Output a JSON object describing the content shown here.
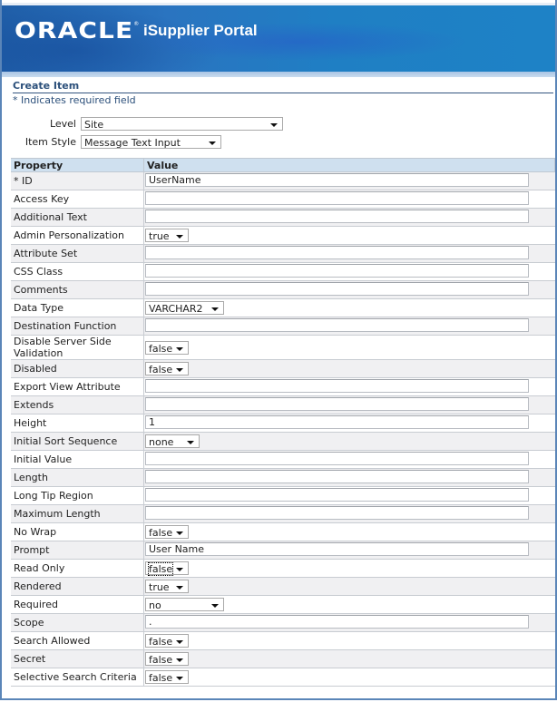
{
  "header": {
    "brand": "ORACLE",
    "brand_mark": "®",
    "product": "iSupplier Portal"
  },
  "page": {
    "title": "Create Item",
    "required_note": "* Indicates required field"
  },
  "form": {
    "level_label": "Level",
    "level_value": "Site",
    "item_style_label": "Item Style",
    "item_style_value": "Message Text Input"
  },
  "table": {
    "headers": [
      "Property",
      "Value"
    ],
    "rows": [
      {
        "property": "* ID",
        "type": "text",
        "value": "UserName"
      },
      {
        "property": "Access Key",
        "type": "text",
        "value": ""
      },
      {
        "property": "Additional Text",
        "type": "text",
        "value": ""
      },
      {
        "property": "Admin Personalization",
        "type": "select",
        "value": "true"
      },
      {
        "property": "Attribute Set",
        "type": "text",
        "value": ""
      },
      {
        "property": "CSS Class",
        "type": "text",
        "value": ""
      },
      {
        "property": "Comments",
        "type": "text",
        "value": ""
      },
      {
        "property": "Data Type",
        "type": "select",
        "value": "VARCHAR2"
      },
      {
        "property": "Destination Function",
        "type": "text",
        "value": ""
      },
      {
        "property": "Disable Server Side Validation",
        "type": "select",
        "value": "false"
      },
      {
        "property": "Disabled",
        "type": "select",
        "value": "false"
      },
      {
        "property": "Export View Attribute",
        "type": "text",
        "value": ""
      },
      {
        "property": "Extends",
        "type": "text",
        "value": ""
      },
      {
        "property": "Height",
        "type": "text",
        "value": "1"
      },
      {
        "property": "Initial Sort Sequence",
        "type": "select",
        "value": "none"
      },
      {
        "property": "Initial Value",
        "type": "text",
        "value": ""
      },
      {
        "property": "Length",
        "type": "text",
        "value": ""
      },
      {
        "property": "Long Tip Region",
        "type": "text",
        "value": ""
      },
      {
        "property": "Maximum Length",
        "type": "text",
        "value": ""
      },
      {
        "property": "No Wrap",
        "type": "select",
        "value": "false"
      },
      {
        "property": "Prompt",
        "type": "text",
        "value": "User Name"
      },
      {
        "property": "Read Only",
        "type": "select",
        "value": "false",
        "focused": true
      },
      {
        "property": "Rendered",
        "type": "select",
        "value": "true"
      },
      {
        "property": "Required",
        "type": "select",
        "value": "no"
      },
      {
        "property": "Scope",
        "type": "text",
        "value": "."
      },
      {
        "property": "Search Allowed",
        "type": "select",
        "value": "false"
      },
      {
        "property": "Secret",
        "type": "select",
        "value": "false"
      },
      {
        "property": "Selective Search Criteria",
        "type": "select",
        "value": "false"
      }
    ]
  }
}
